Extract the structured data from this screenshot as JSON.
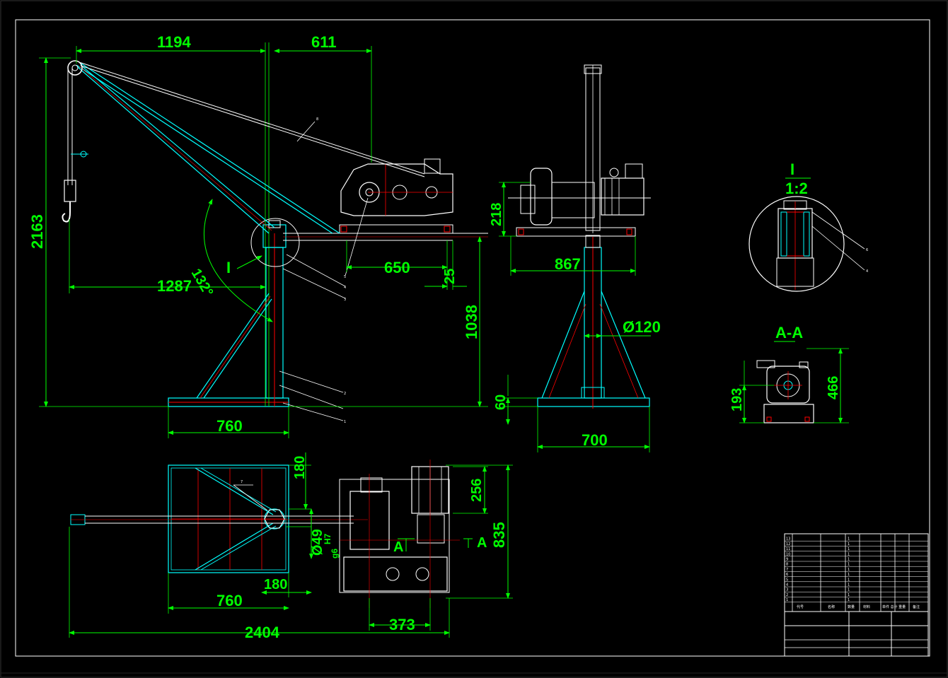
{
  "drawing": {
    "background": "#000000",
    "colors": {
      "dimension": "#00ff00",
      "outline": "#ffffff",
      "part": "#00ffff",
      "center": "#ff0000",
      "frame": "#ffffff"
    },
    "front_view": {
      "dims": {
        "jib_span": "1194",
        "winch_offset": "611",
        "total_height": "2163",
        "reach": "1287",
        "angle": "132°",
        "winch_base": "650",
        "winch_edge": "25",
        "column_height": "1038",
        "base_length": "760",
        "detail_mark": "I"
      },
      "callouts": [
        "8",
        "5",
        "4",
        "3",
        "2",
        "1"
      ]
    },
    "side_view": {
      "dims": {
        "winch_height": "218",
        "winch_width": "867",
        "column_dia": "Ø120",
        "base_height": "60",
        "base_width": "700"
      }
    },
    "detail_view": {
      "title": "I",
      "scale": "1:2",
      "callouts": [
        "6",
        "4"
      ]
    },
    "section_view": {
      "title": "A-A",
      "dims": {
        "height": "466",
        "center": "193"
      }
    },
    "top_view": {
      "dims": {
        "frame_top": "180",
        "motor": "256",
        "total_depth": "835",
        "shaft_fit": "Ø49",
        "fit_upper": "H7",
        "fit_lower": "g6",
        "frame_bottom": "180",
        "base_length": "760",
        "overall_length": "2404",
        "gearbox": "373",
        "section_mark": "A",
        "section_mark_right": "A"
      },
      "callouts": [
        "7"
      ]
    }
  },
  "title_block": {
    "header": {
      "code": "代号",
      "name": "名称",
      "qty": "数量",
      "material": "材料",
      "weight": "单件 总计 重量",
      "remark": "备注"
    },
    "rows": [
      [
        "13",
        "",
        "",
        "1",
        "",
        ""
      ],
      [
        "12",
        "",
        "",
        "1",
        "",
        ""
      ],
      [
        "11",
        "",
        "",
        "1",
        "",
        ""
      ],
      [
        "10",
        "",
        "",
        "1",
        "",
        ""
      ],
      [
        "9",
        "",
        "",
        "1",
        "",
        ""
      ],
      [
        "8",
        "",
        "",
        "1",
        "",
        ""
      ],
      [
        "7",
        "",
        "",
        "1",
        "",
        ""
      ],
      [
        "6",
        "",
        "",
        "1",
        "",
        ""
      ],
      [
        "5",
        "",
        "",
        "1",
        "",
        ""
      ],
      [
        "4",
        "",
        "",
        "1",
        "",
        ""
      ],
      [
        "3",
        "",
        "",
        "1",
        "",
        ""
      ],
      [
        "2",
        "",
        "",
        "1",
        "",
        ""
      ],
      [
        "1",
        "",
        "",
        "1",
        "",
        ""
      ]
    ],
    "drawing_title": "",
    "drawing_number": "",
    "scale": "",
    "sheet": ""
  }
}
